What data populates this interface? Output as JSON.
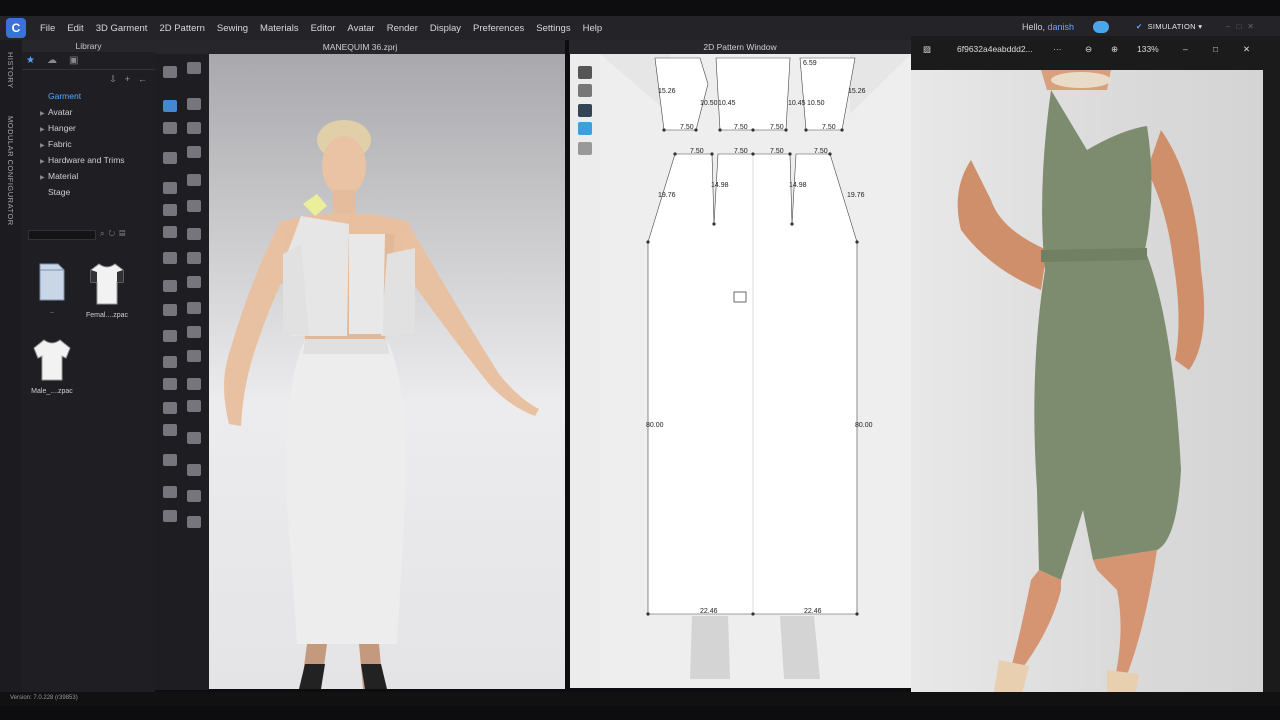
{
  "app": {
    "menu": [
      "File",
      "Edit",
      "3D Garment",
      "2D Pattern",
      "Sewing",
      "Materials",
      "Editor",
      "Avatar",
      "Render",
      "Display",
      "Preferences",
      "Settings",
      "Help"
    ],
    "greeting_prefix": "Hello,",
    "username": "danish",
    "mode": "SIMULATION",
    "version": "Version: 7.0.228 (r39853)"
  },
  "side_strip": {
    "history": "HISTORY",
    "modular": "MODULAR CONFIGURATOR"
  },
  "library": {
    "title": "Library",
    "tree": [
      {
        "label": "Garment",
        "selected": true,
        "arrow": false
      },
      {
        "label": "Avatar",
        "selected": false,
        "arrow": true
      },
      {
        "label": "Hanger",
        "selected": false,
        "arrow": true
      },
      {
        "label": "Fabric",
        "selected": false,
        "arrow": true
      },
      {
        "label": "Hardware and Trims",
        "selected": false,
        "arrow": true
      },
      {
        "label": "Material",
        "selected": false,
        "arrow": true
      },
      {
        "label": "Stage",
        "selected": false,
        "arrow": false
      }
    ],
    "files": [
      {
        "label": "..",
        "icon": "folder-icon"
      },
      {
        "label": "Femal....zpac",
        "icon": "shirt-icon"
      },
      {
        "label": "Male_....zpac",
        "icon": "shirt-icon"
      }
    ]
  },
  "viewport3d": {
    "title": "MANEQUIM 36.zprj"
  },
  "pattern2d": {
    "title": "2D Pattern Window",
    "labels": [
      "6.59",
      "15.26",
      "10.50",
      "10.45",
      "10.45",
      "10.50",
      "15.26",
      "7.50",
      "7.50",
      "7.50",
      "7.50",
      "7.50",
      "7.50",
      "7.50",
      "7.50",
      "19.76",
      "14.98",
      "14.98",
      "19.76",
      "80.00",
      "80.00",
      "22.46",
      "22.46"
    ]
  },
  "viewer": {
    "filename": "6f9632a4eabddd2...",
    "more": "···",
    "zoom": "133%"
  },
  "colors": {
    "accent": "#4ea3ff",
    "dress": "#7d8b6e",
    "pattern_bg": "#eeeeee"
  }
}
